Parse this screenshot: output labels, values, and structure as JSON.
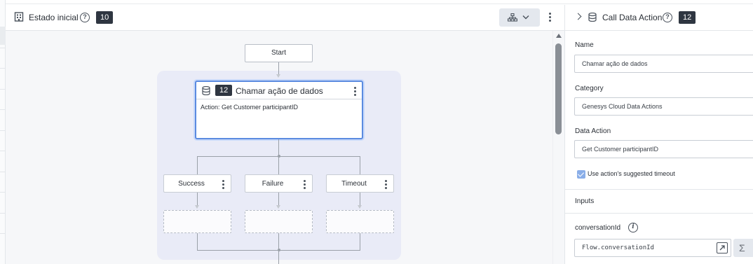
{
  "flow_panel": {
    "title": "Estado inicial",
    "help_icon": "?",
    "badge": "10"
  },
  "flow": {
    "start_label": "Start",
    "action": {
      "badge": "12",
      "title": "Chamar ação de dados",
      "description": "Action: Get Customer participantID"
    },
    "outputs": [
      {
        "label": "Success"
      },
      {
        "label": "Failure"
      },
      {
        "label": "Timeout"
      }
    ]
  },
  "properties": {
    "title": "Call Data Action",
    "help_icon": "?",
    "badge": "12",
    "name_label": "Name",
    "name_value": "Chamar ação de dados",
    "category_label": "Category",
    "category_value": "Genesys Cloud Data Actions",
    "data_action_label": "Data Action",
    "data_action_value": "Get Customer participantID",
    "timeout_checkbox_label": "Use action's suggested timeout",
    "inputs_heading": "Inputs",
    "input_name": "conversationId",
    "info_icon": "i",
    "input_value": "Flow.conversationId",
    "sum_symbol": "Σ"
  },
  "colors": {
    "accent": "#5b8be0",
    "badge_bg": "#2f3641",
    "group_bg": "#e9ebf7"
  }
}
